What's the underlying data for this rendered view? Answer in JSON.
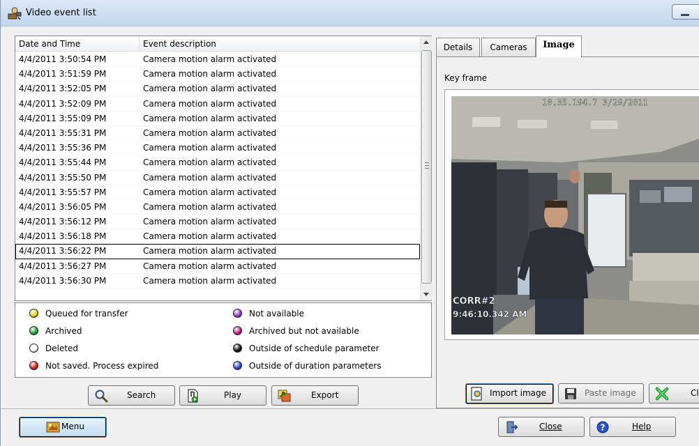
{
  "window": {
    "title": "Video event list"
  },
  "event_list": {
    "columns": [
      "Date and Time",
      "Event description"
    ],
    "rows": [
      {
        "date": "4/4/2011 3:50:54 PM",
        "desc": "Camera motion alarm activated"
      },
      {
        "date": "4/4/2011 3:51:59 PM",
        "desc": "Camera motion alarm activated"
      },
      {
        "date": "4/4/2011 3:52:05 PM",
        "desc": "Camera motion alarm activated"
      },
      {
        "date": "4/4/2011 3:52:09 PM",
        "desc": "Camera motion alarm activated"
      },
      {
        "date": "4/4/2011 3:55:09 PM",
        "desc": "Camera motion alarm activated"
      },
      {
        "date": "4/4/2011 3:55:31 PM",
        "desc": "Camera motion alarm activated"
      },
      {
        "date": "4/4/2011 3:55:36 PM",
        "desc": "Camera motion alarm activated"
      },
      {
        "date": "4/4/2011 3:55:44 PM",
        "desc": "Camera motion alarm activated"
      },
      {
        "date": "4/4/2011 3:55:50 PM",
        "desc": "Camera motion alarm activated"
      },
      {
        "date": "4/4/2011 3:55:57 PM",
        "desc": "Camera motion alarm activated"
      },
      {
        "date": "4/4/2011 3:56:05 PM",
        "desc": "Camera motion alarm activated"
      },
      {
        "date": "4/4/2011 3:56:12 PM",
        "desc": "Camera motion alarm activated"
      },
      {
        "date": "4/4/2011 3:56:18 PM",
        "desc": "Camera motion alarm activated"
      },
      {
        "date": "4/4/2011 3:56:22 PM",
        "desc": "Camera motion alarm activated",
        "selected": true
      },
      {
        "date": "4/4/2011 3:56:27 PM",
        "desc": "Camera motion alarm activated"
      },
      {
        "date": "4/4/2011 3:56:30 PM",
        "desc": "Camera motion alarm activated"
      }
    ]
  },
  "legend": [
    {
      "label": "Queued for transfer",
      "color": "#e8d21a"
    },
    {
      "label": "Archived",
      "color": "#1fa83a"
    },
    {
      "label": "Deleted",
      "color": "#ffffff"
    },
    {
      "label": "Not saved. Process expired",
      "color": "#d9211d"
    },
    {
      "label": "Not available",
      "color": "#9a3fd6"
    },
    {
      "label": "Archived but not available",
      "color": "#c21c88"
    },
    {
      "label": "Outside of schedule parameter",
      "color": "#111111"
    },
    {
      "label": "Outside of duration parameters",
      "color": "#2a45d8"
    }
  ],
  "actions": {
    "search": "Search",
    "play": "Play",
    "export": "Export"
  },
  "tabs": [
    {
      "label": "Details",
      "active": false
    },
    {
      "label": "Cameras",
      "active": false
    },
    {
      "label": "Image",
      "active": true
    }
  ],
  "image_tab": {
    "key_frame_label": "Key frame",
    "overlay_top": "10.35.194.7 3/29/2011",
    "overlay_camera": "CORR#2",
    "overlay_time": "9:46:10.342 AM",
    "import_label": "Import image",
    "paste_label": "Paste image",
    "clear_label": "Cl"
  },
  "footer": {
    "menu_label": "Menu",
    "close_label": "Close",
    "help_label": "Help"
  },
  "icons": {
    "app": "app-icon",
    "search": "magnifier-icon",
    "play": "play-icon",
    "export": "export-icon",
    "import": "import-icon",
    "paste": "floppy-icon",
    "clear": "green-x-icon",
    "menu": "menu-icon",
    "close": "exit-door-icon",
    "help": "help-icon"
  }
}
